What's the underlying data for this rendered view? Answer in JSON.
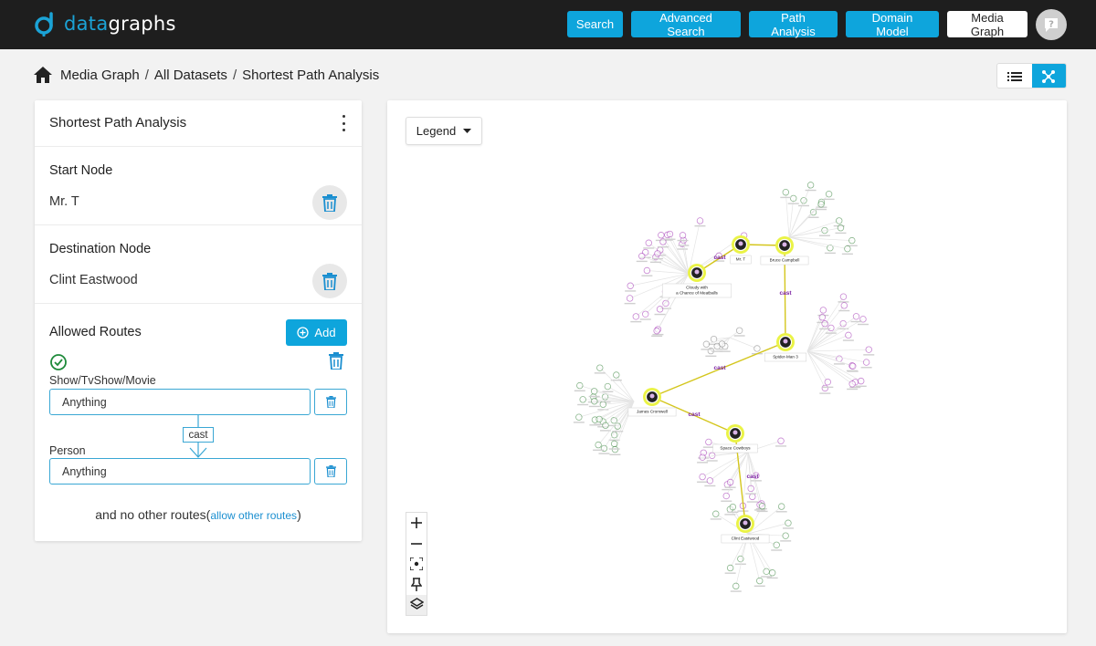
{
  "app": {
    "logo_prefix": "data",
    "logo_suffix": "graphs"
  },
  "nav": {
    "search": "Search",
    "advanced_search": "Advanced Search",
    "path_analysis": "Path Analysis",
    "domain_model": "Domain Model",
    "media_graph": "Media Graph"
  },
  "breadcrumb": {
    "items": [
      "Media Graph",
      "All Datasets",
      "Shortest Path Analysis"
    ],
    "separator": "/"
  },
  "panel": {
    "title": "Shortest Path Analysis",
    "start_label": "Start Node",
    "start_value": "Mr. T",
    "dest_label": "Destination Node",
    "dest_value": "Clint Eastwood",
    "routes_label": "Allowed Routes",
    "add_label": "Add",
    "route_from_label": "Show/TvShow/Movie",
    "route_from_value": "Anything",
    "edge_label": "cast",
    "route_to_label": "Person",
    "route_to_value": "Anything",
    "footer_prefix": "and no other routes(",
    "footer_link": "allow other routes",
    "footer_suffix": ")"
  },
  "graph": {
    "legend_label": "Legend",
    "path_nodes": [
      {
        "id": "mrt",
        "label": "Mr. T"
      },
      {
        "id": "bruce",
        "label": "Bruce Campbell"
      },
      {
        "id": "cloudy",
        "label": "Cloudy with a Chance of Meatballs"
      },
      {
        "id": "spider",
        "label": "Spider-Man 3"
      },
      {
        "id": "james",
        "label": "James Cromwell"
      },
      {
        "id": "space",
        "label": "Space Cowboys"
      },
      {
        "id": "clint",
        "label": "Clint Eastwood"
      }
    ],
    "edge_label": "cast",
    "colors": {
      "accent": "#0ea5dc",
      "path_edge": "#d4c61d",
      "path_halo": "#eaf346",
      "edge_label": "#7b1fa2",
      "person_node": "#9c27b0",
      "show_node": "#2e7d32"
    }
  },
  "icons": {
    "home": "home-icon",
    "help": "help-icon",
    "list_view": "list-view-icon",
    "graph_view": "graph-view-icon",
    "trash": "trash-icon",
    "check": "check-circle-icon",
    "add": "add-circle-icon",
    "kebab": "more-vert-icon",
    "caret": "caret-down-icon",
    "zoom_in": "zoom-in-icon",
    "zoom_out": "zoom-out-icon",
    "fit": "fit-view-icon",
    "pin": "pin-icon",
    "layers": "layers-icon"
  }
}
